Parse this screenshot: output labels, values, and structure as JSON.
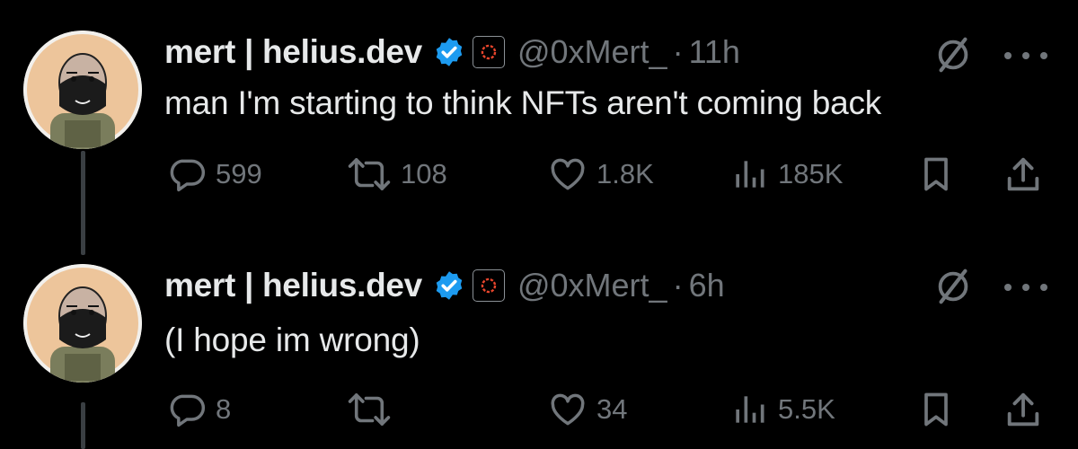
{
  "tweets": [
    {
      "display_name": "mert | helius.dev",
      "handle": "@0xMert_",
      "dot": "·",
      "time": "11h",
      "text": "man I'm starting to think NFTs aren't coming back",
      "replies": "599",
      "reposts": "108",
      "likes": "1.8K",
      "views": "185K"
    },
    {
      "display_name": "mert | helius.dev",
      "handle": "@0xMert_",
      "dot": "·",
      "time": "6h",
      "text": "(I hope im wrong)",
      "replies": "8",
      "reposts": "",
      "likes": "34",
      "views": "5.5K"
    }
  ],
  "icons": {
    "verified": "verified-badge-icon",
    "affiliate": "helius-affiliate-icon",
    "grok": "grok-icon",
    "more": "more-icon",
    "reply": "reply-icon",
    "repost": "repost-icon",
    "like": "heart-icon",
    "views": "views-icon",
    "bookmark": "bookmark-icon",
    "share": "share-icon"
  },
  "colors": {
    "background": "#000000",
    "text": "#e7e9ea",
    "secondary": "#71767b",
    "verified": "#1d9bf0",
    "affiliate": "#e8452c"
  }
}
